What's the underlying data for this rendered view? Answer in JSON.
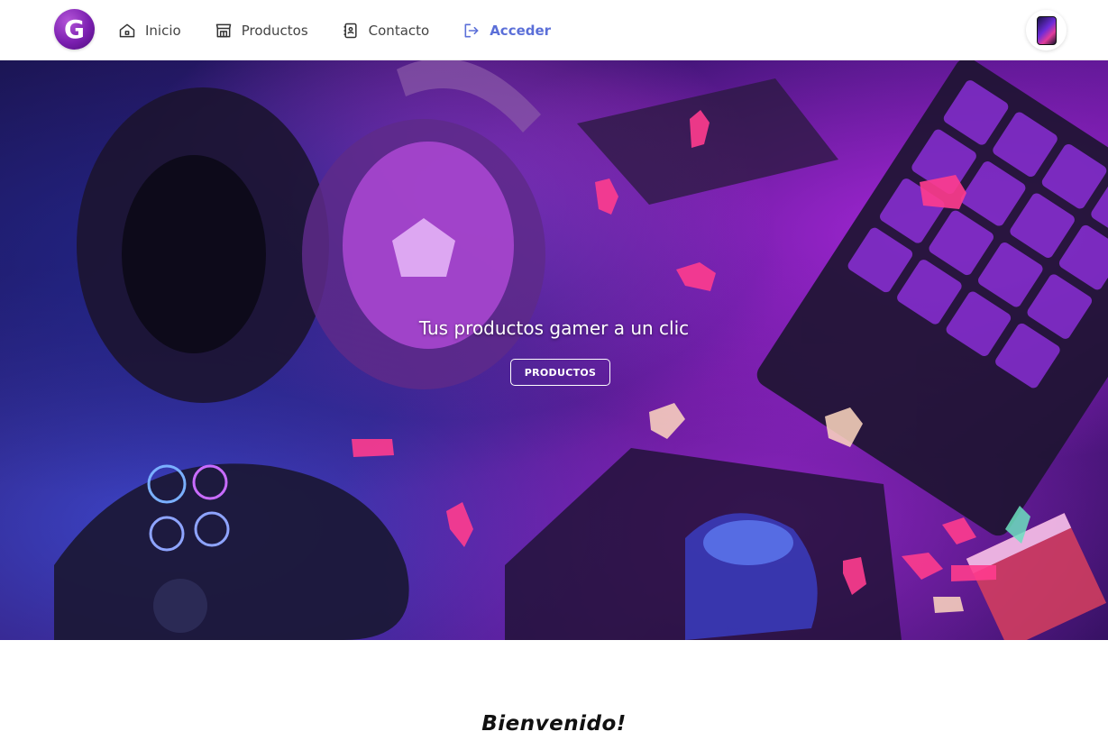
{
  "navbar": {
    "logo_letter": "G",
    "items": [
      {
        "label": "Inicio",
        "icon": "home-icon"
      },
      {
        "label": "Productos",
        "icon": "store-icon"
      },
      {
        "label": "Contacto",
        "icon": "address-book-icon"
      },
      {
        "label": "Acceder",
        "icon": "login-icon"
      }
    ],
    "accent_color": "#5b6fd8",
    "avatar_icon": "phone-icon"
  },
  "hero": {
    "title": "Tus productos gamer a un clic",
    "button_label": "PRODUCTOS"
  },
  "welcome": {
    "heading": "Bienvenido!"
  }
}
